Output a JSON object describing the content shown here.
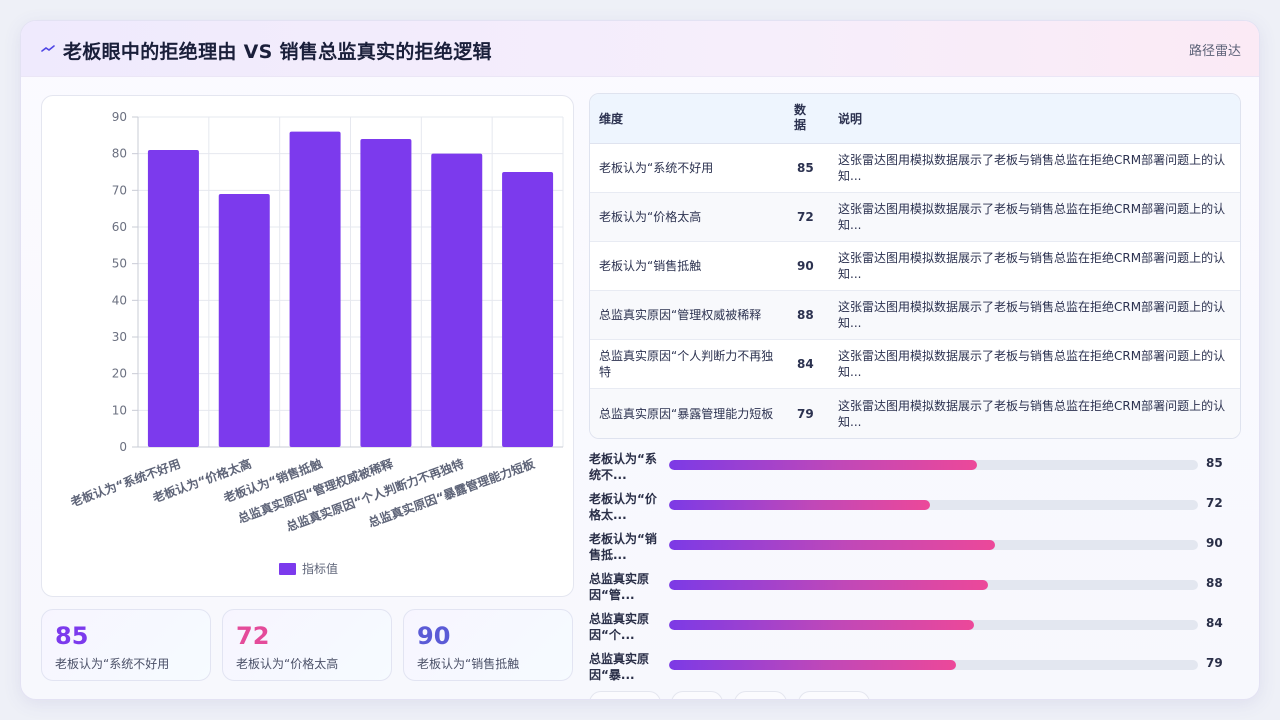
{
  "header": {
    "title": "老板眼中的拒绝理由 VS 销售总监真实的拒绝逻辑",
    "link": "路径雷达",
    "icon": "wave-icon"
  },
  "chart_data": {
    "type": "bar",
    "categories": [
      "老板认为“系统不好用",
      "老板认为“价格太高",
      "老板认为“销售抵触",
      "总监真实原因“管理权威被稀释",
      "总监真实原因“个人判断力不再独特",
      "总监真实原因“暴露管理能力短板"
    ],
    "series": [
      {
        "name": "指标值",
        "values": [
          81,
          69,
          86,
          84,
          80,
          75
        ]
      }
    ],
    "ylim": [
      0,
      90
    ],
    "yticks": [
      0,
      10,
      20,
      30,
      40,
      50,
      60,
      70,
      80,
      90
    ],
    "grid": true,
    "legend": "bottom",
    "bar_color": "#7c3aed"
  },
  "stats": [
    {
      "value": "85",
      "label": "老板认为“系统不好用",
      "color": "#7c3aed"
    },
    {
      "value": "72",
      "label": "老板认为“价格太高",
      "color": "#e44b9a"
    },
    {
      "value": "90",
      "label": "老板认为“销售抵触",
      "color": "#5b5bd6"
    }
  ],
  "table": {
    "headers": [
      "维度",
      "数据",
      "说明"
    ],
    "rows": [
      {
        "dim": "老板认为“系统不好用",
        "value": "85",
        "desc": "这张雷达图用模拟数据展示了老板与销售总监在拒绝CRM部署问题上的认知..."
      },
      {
        "dim": "老板认为“价格太高",
        "value": "72",
        "desc": "这张雷达图用模拟数据展示了老板与销售总监在拒绝CRM部署问题上的认知..."
      },
      {
        "dim": "老板认为“销售抵触",
        "value": "90",
        "desc": "这张雷达图用模拟数据展示了老板与销售总监在拒绝CRM部署问题上的认知..."
      },
      {
        "dim": "总监真实原因“管理权威被稀释",
        "value": "88",
        "desc": "这张雷达图用模拟数据展示了老板与销售总监在拒绝CRM部署问题上的认知..."
      },
      {
        "dim": "总监真实原因“个人判断力不再独特",
        "value": "84",
        "desc": "这张雷达图用模拟数据展示了老板与销售总监在拒绝CRM部署问题上的认知..."
      },
      {
        "dim": "总监真实原因“暴露管理能力短板",
        "value": "79",
        "desc": "这张雷达图用模拟数据展示了老板与销售总监在拒绝CRM部署问题上的认知..."
      }
    ]
  },
  "progress": [
    {
      "label": "老板认为“系统不...",
      "value": "85",
      "fraction": 0.583
    },
    {
      "label": "老板认为“价格太...",
      "value": "72",
      "fraction": 0.494
    },
    {
      "label": "老板认为“销售抵...",
      "value": "90",
      "fraction": 0.617
    },
    {
      "label": "总监真实原因“管...",
      "value": "88",
      "fraction": 0.603
    },
    {
      "label": "总监真实原因“个...",
      "value": "84",
      "fraction": 0.576
    },
    {
      "label": "总监真实原因“暴...",
      "value": "79",
      "fraction": 0.542
    }
  ]
}
